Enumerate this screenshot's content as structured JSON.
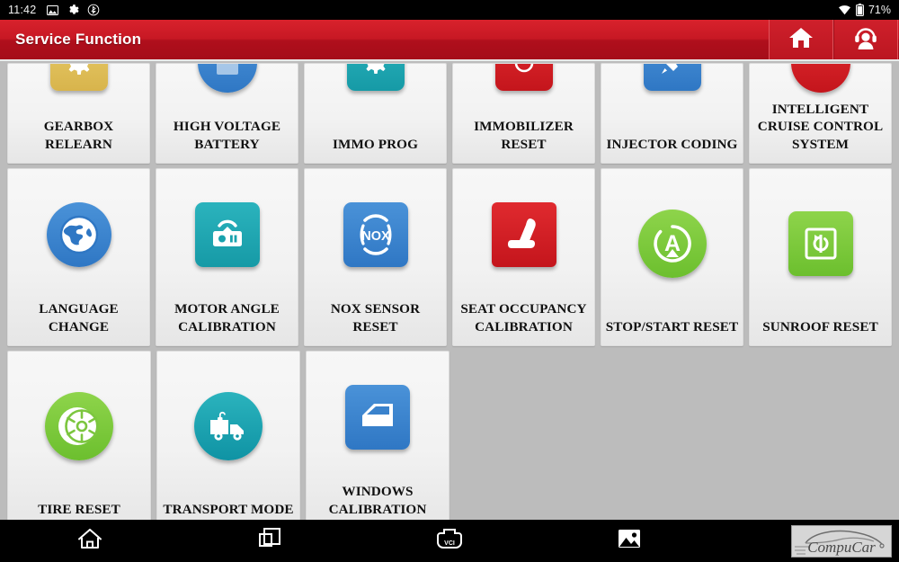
{
  "statusbar": {
    "time": "11:42",
    "battery_pct": "71%",
    "icons": [
      "photo-icon",
      "gear-icon",
      "bluetooth-icon"
    ],
    "right_icons": [
      "wifi-icon",
      "battery-icon"
    ]
  },
  "header": {
    "title": "Service Function",
    "buttons": [
      {
        "name": "home-button",
        "icon": "home-icon"
      },
      {
        "name": "support-button",
        "icon": "headset-icon"
      }
    ],
    "accent_color": "#c71824"
  },
  "grid": {
    "rows": [
      {
        "tiles": [
          {
            "label": "GEARBOX RELEARN",
            "icon": "gearbox-relearn-icon"
          },
          {
            "label": "HIGH VOLTAGE BATTERY",
            "icon": "high-voltage-battery-icon"
          },
          {
            "label": "IMMO PROG",
            "icon": "immo-prog-icon"
          },
          {
            "label": "IMMOBILIZER RESET",
            "icon": "immobilizer-reset-icon"
          },
          {
            "label": "INJECTOR CODING",
            "icon": "injector-coding-icon"
          },
          {
            "label": "INTELLIGENT CRUISE CONTROL SYSTEM",
            "icon": "intelligent-cruise-control-icon"
          }
        ]
      },
      {
        "tiles": [
          {
            "label": "LANGUAGE CHANGE",
            "icon": "language-change-icon"
          },
          {
            "label": "MOTOR ANGLE CALIBRATION",
            "icon": "motor-angle-calibration-icon"
          },
          {
            "label": "NOX SENSOR RESET",
            "icon": "nox-sensor-reset-icon"
          },
          {
            "label": "SEAT OCCUPANCY CALIBRATION",
            "icon": "seat-occupancy-calibration-icon"
          },
          {
            "label": "STOP/START RESET",
            "icon": "stop-start-reset-icon"
          },
          {
            "label": "SUNROOF RESET",
            "icon": "sunroof-reset-icon"
          }
        ]
      },
      {
        "tiles": [
          {
            "label": "TIRE RESET",
            "icon": "tire-reset-icon"
          },
          {
            "label": "TRANSPORT MODE",
            "icon": "transport-mode-icon"
          },
          {
            "label": "WINDOWS CALIBRATION",
            "icon": "windows-calibration-icon"
          }
        ]
      }
    ]
  },
  "navbar": {
    "buttons": [
      {
        "name": "nav-home",
        "icon": "home-outline-icon"
      },
      {
        "name": "nav-recents",
        "icon": "recent-apps-icon"
      },
      {
        "name": "nav-vci",
        "icon": "vci-icon",
        "label": "VCI"
      },
      {
        "name": "nav-screenshot",
        "icon": "image-icon"
      },
      {
        "name": "nav-back",
        "icon": "back-arrow-icon"
      }
    ],
    "logo_text": "CompuCar"
  }
}
